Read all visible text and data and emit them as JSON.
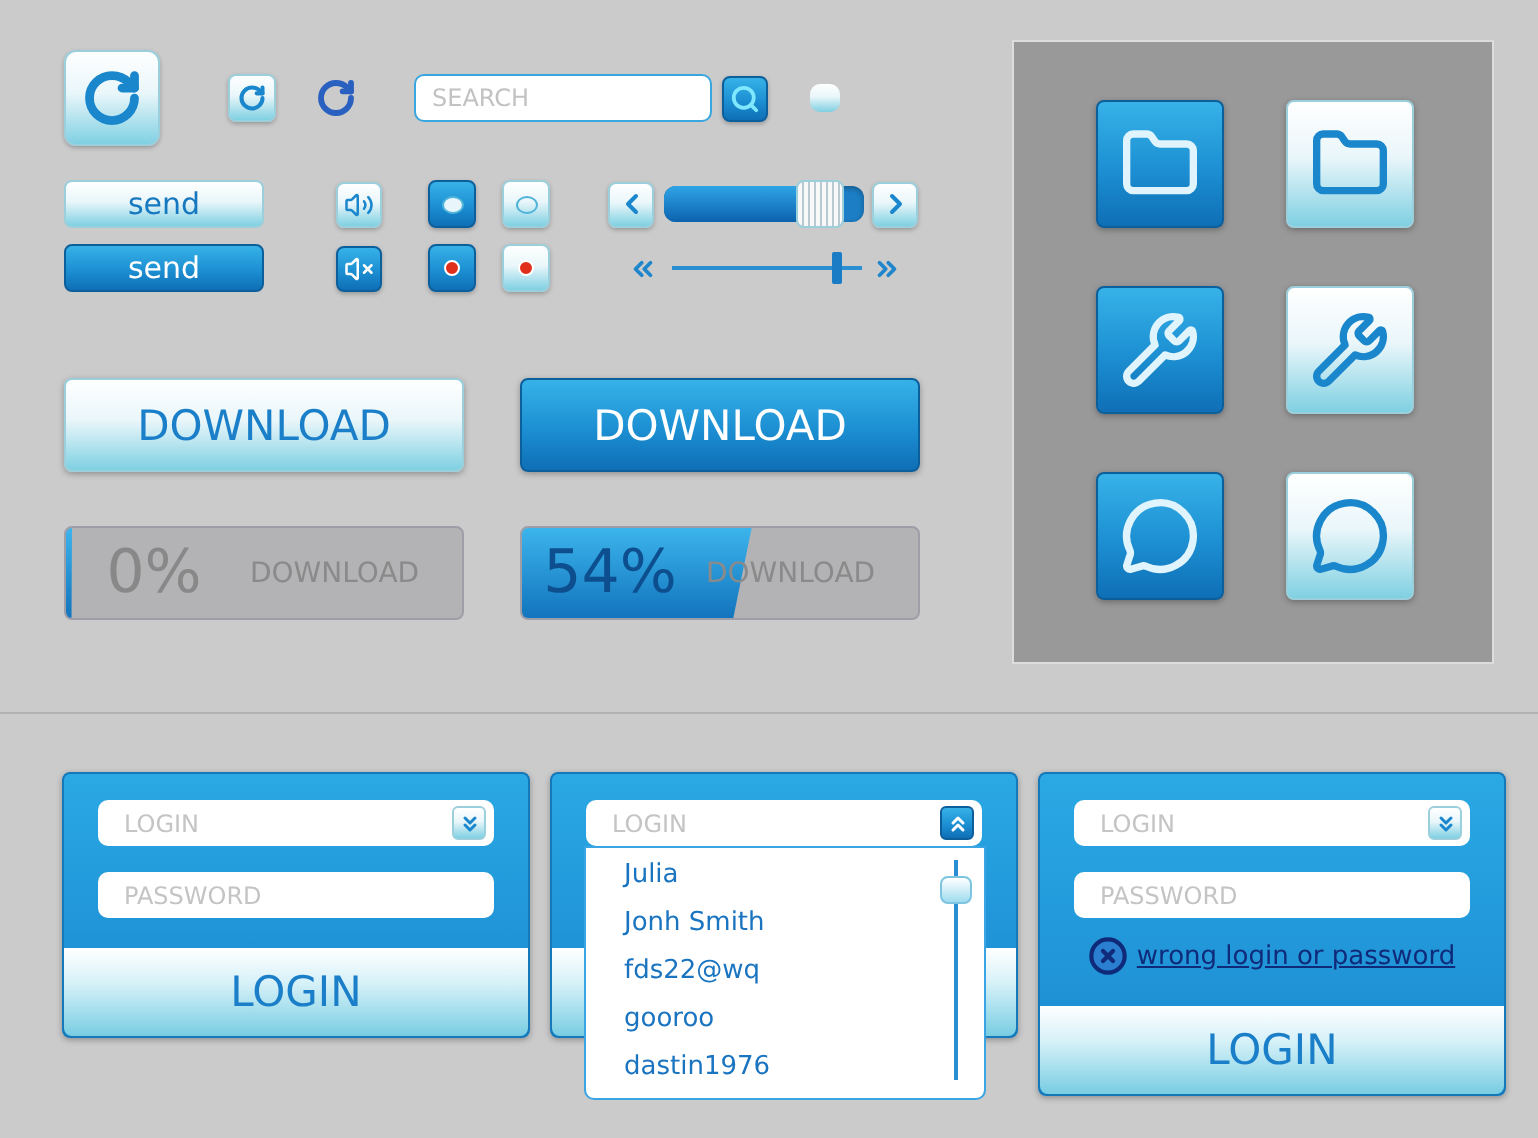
{
  "search": {
    "placeholder": "SEARCH"
  },
  "toggle": {
    "on": false
  },
  "send_buttons": [
    {
      "label": "send",
      "pressed": false
    },
    {
      "label": "send",
      "pressed": true
    }
  ],
  "audio_buttons": [
    {
      "muted": false
    },
    {
      "muted": true
    }
  ],
  "option_buttons": [
    {
      "kind": "dot",
      "selected": true
    },
    {
      "kind": "dot",
      "selected": false
    },
    {
      "kind": "record",
      "selected": true
    },
    {
      "kind": "record",
      "selected": false
    }
  ],
  "sliders": [
    {
      "kind": "thick",
      "level": 0.78
    },
    {
      "kind": "thin",
      "level": 0.86
    }
  ],
  "download_buttons": [
    {
      "label": "DOWNLOAD",
      "pressed": false
    },
    {
      "label": "DOWNLOAD",
      "pressed": true
    }
  ],
  "progress_bars": [
    {
      "percent": "0%",
      "label": "DOWNLOAD",
      "level": 0
    },
    {
      "percent": "54%",
      "label": "DOWNLOAD",
      "level": 0.54
    }
  ],
  "icon_tiles": [
    {
      "pressed": true
    },
    {
      "pressed": false
    },
    {
      "pressed": true
    },
    {
      "pressed": false
    },
    {
      "pressed": true
    },
    {
      "pressed": false
    }
  ],
  "login_panels": [
    {
      "login_placeholder": "LOGIN",
      "password_placeholder": "PASSWORD",
      "button": "LOGIN",
      "dropdown_open": false
    },
    {
      "login_placeholder": "LOGIN",
      "dropdown_open": true,
      "dropdown_items": [
        "Julia",
        "Jonh Smith",
        "fds22@wq",
        "gooroo",
        "dastin1976"
      ]
    },
    {
      "login_placeholder": "LOGIN",
      "password_placeholder": "PASSWORD",
      "error": "wrong login or password",
      "button": "LOGIN",
      "dropdown_open": false
    }
  ]
}
